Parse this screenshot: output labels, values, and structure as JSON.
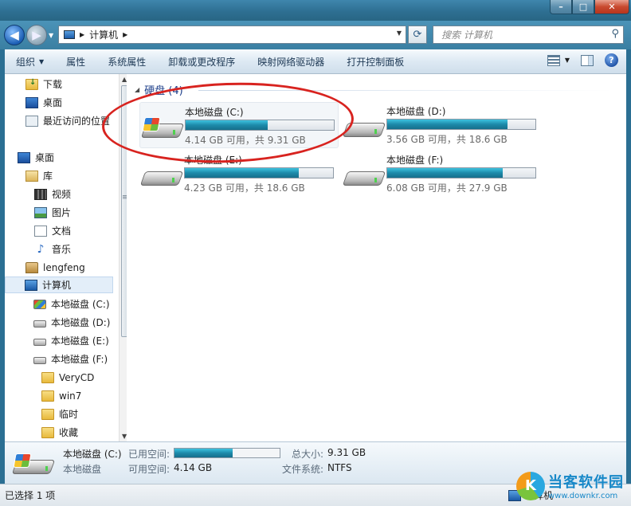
{
  "window": {
    "caption_buttons": [
      "–",
      "□",
      "✕"
    ]
  },
  "address": {
    "path": "计算机",
    "search_placeholder": "搜索 计算机"
  },
  "toolbar": {
    "items": [
      "组织",
      "属性",
      "系统属性",
      "卸载或更改程序",
      "映射网络驱动器",
      "打开控制面板"
    ]
  },
  "nav": {
    "items": [
      {
        "label": "下载",
        "icon": "download-folder-icon"
      },
      {
        "label": "桌面",
        "icon": "desktop-icon"
      },
      {
        "label": "最近访问的位置",
        "icon": "recent-places-icon"
      },
      {
        "label": "桌面",
        "icon": "desktop-icon"
      },
      {
        "label": "库",
        "icon": "library-icon"
      },
      {
        "label": "视频",
        "icon": "video-icon"
      },
      {
        "label": "图片",
        "icon": "pictures-icon"
      },
      {
        "label": "文档",
        "icon": "documents-icon"
      },
      {
        "label": "音乐",
        "icon": "music-icon"
      },
      {
        "label": "lengfeng",
        "icon": "user-folder-icon"
      },
      {
        "label": "计算机",
        "icon": "computer-icon"
      },
      {
        "label": "本地磁盘 (C:)",
        "icon": "system-drive-icon"
      },
      {
        "label": "本地磁盘 (D:)",
        "icon": "drive-icon"
      },
      {
        "label": "本地磁盘 (E:)",
        "icon": "drive-icon"
      },
      {
        "label": "本地磁盘 (F:)",
        "icon": "drive-icon"
      },
      {
        "label": "VeryCD",
        "icon": "folder-icon"
      },
      {
        "label": "win7",
        "icon": "folder-icon"
      },
      {
        "label": "临时",
        "icon": "folder-icon"
      },
      {
        "label": "收藏",
        "icon": "folder-icon"
      }
    ]
  },
  "content": {
    "group_title": "硬盘 (4)",
    "drives": [
      {
        "name": "本地磁盘 (C:)",
        "size_text": "4.14 GB 可用，共 9.31 GB",
        "used_fraction": 0.555
      },
      {
        "name": "本地磁盘 (D:)",
        "size_text": "3.56 GB 可用，共 18.6 GB",
        "used_fraction": 0.81
      },
      {
        "name": "本地磁盘 (E:)",
        "size_text": "4.23 GB 可用，共 18.6 GB",
        "used_fraction": 0.77
      },
      {
        "name": "本地磁盘 (F:)",
        "size_text": "6.08 GB 可用，共 27.9 GB",
        "used_fraction": 0.78
      }
    ]
  },
  "details": {
    "name": "本地磁盘 (C:)",
    "type": "本地磁盘",
    "used_label": "已用空间:",
    "used_fraction": 0.555,
    "free_label": "可用空间:",
    "free_value": "4.14 GB",
    "total_label": "总大小:",
    "total_value": "9.31 GB",
    "fs_label": "文件系统:",
    "fs_value": "NTFS"
  },
  "status": {
    "text": "已选择 1 项",
    "location": "计算机"
  },
  "watermark": {
    "title": "当客软件园",
    "url": "www.downkr.com",
    "logo_letter": "K"
  }
}
